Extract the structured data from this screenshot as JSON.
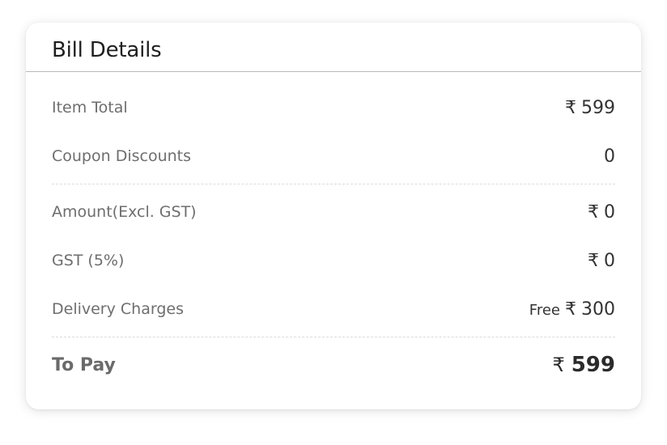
{
  "bill": {
    "title": "Bill Details",
    "currency_symbol": "₹",
    "item_total": {
      "label": "Item Total",
      "value": "599"
    },
    "coupon_discounts": {
      "label": "Coupon Discounts",
      "value": "0"
    },
    "amount_excl_gst": {
      "label": "Amount(Excl. GST)",
      "value": "0"
    },
    "gst": {
      "label": "GST (5%)",
      "value": "0"
    },
    "delivery_charges": {
      "label": "Delivery Charges",
      "free_label": "Free",
      "value": "300"
    },
    "to_pay": {
      "label": "To Pay",
      "value": "599"
    }
  }
}
